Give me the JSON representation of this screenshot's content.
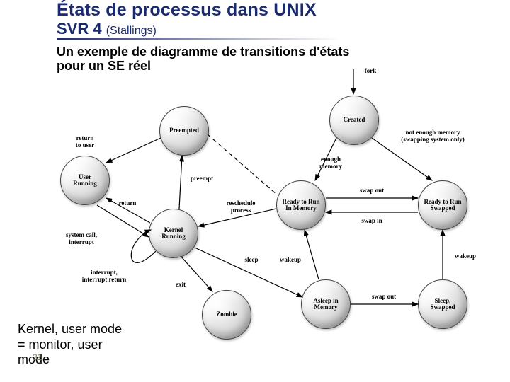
{
  "title_main": "États de processus dans UNIX",
  "title_line2_a": "SVR 4 ",
  "title_line2_b": "(Stallings)",
  "subtitle_line1": "Un exemple de diagramme de transitions d'états",
  "subtitle_line2": "pour un SE réel",
  "note_text": "Kernel, user mode = monitor, user mode",
  "page_number": "31",
  "nodes": {
    "user_running": "User\nRunning",
    "kernel_running": "Kernel\nRunning",
    "preempted": "Preempted",
    "zombie": "Zombie",
    "created": "Created",
    "ready_mem": "Ready to Run\nIn Memory",
    "asleep_mem": "Asleep in\nMemory",
    "ready_swapped": "Ready to Run\nSwapped",
    "sleep_swapped": "Sleep,\nSwapped"
  },
  "edges": {
    "fork": "fork",
    "return_to_user": "return\nto user",
    "preempt": "preempt",
    "return": "return",
    "syscall": "system call,\ninterrupt",
    "int_ret": "interrupt,\ninterrupt return",
    "exit": "exit",
    "reschedule": "reschedule\nprocess",
    "sleep": "sleep",
    "wakeup1": "wakeup",
    "wakeup2": "wakeup",
    "enough_mem": "enough\nmemory",
    "not_enough": "not enough memory\n(swapping system only)",
    "swap_out1": "swap out",
    "swap_in": "swap in",
    "swap_out2": "swap out"
  }
}
